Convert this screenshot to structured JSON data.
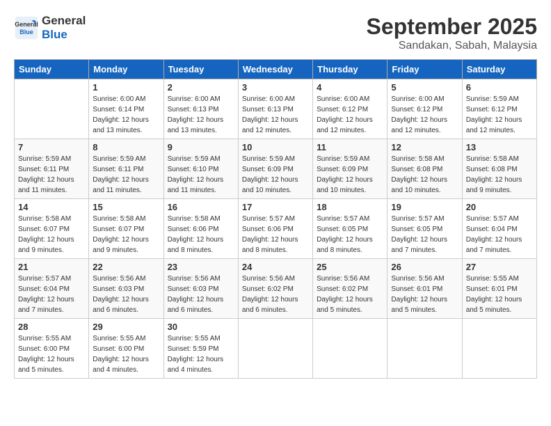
{
  "logo": {
    "line1": "General",
    "line2": "Blue"
  },
  "title": "September 2025",
  "subtitle": "Sandakan, Sabah, Malaysia",
  "days_header": [
    "Sunday",
    "Monday",
    "Tuesday",
    "Wednesday",
    "Thursday",
    "Friday",
    "Saturday"
  ],
  "weeks": [
    [
      {
        "num": "",
        "info": ""
      },
      {
        "num": "1",
        "info": "Sunrise: 6:00 AM\nSunset: 6:14 PM\nDaylight: 12 hours\nand 13 minutes."
      },
      {
        "num": "2",
        "info": "Sunrise: 6:00 AM\nSunset: 6:13 PM\nDaylight: 12 hours\nand 13 minutes."
      },
      {
        "num": "3",
        "info": "Sunrise: 6:00 AM\nSunset: 6:13 PM\nDaylight: 12 hours\nand 12 minutes."
      },
      {
        "num": "4",
        "info": "Sunrise: 6:00 AM\nSunset: 6:12 PM\nDaylight: 12 hours\nand 12 minutes."
      },
      {
        "num": "5",
        "info": "Sunrise: 6:00 AM\nSunset: 6:12 PM\nDaylight: 12 hours\nand 12 minutes."
      },
      {
        "num": "6",
        "info": "Sunrise: 5:59 AM\nSunset: 6:12 PM\nDaylight: 12 hours\nand 12 minutes."
      }
    ],
    [
      {
        "num": "7",
        "info": "Sunrise: 5:59 AM\nSunset: 6:11 PM\nDaylight: 12 hours\nand 11 minutes."
      },
      {
        "num": "8",
        "info": "Sunrise: 5:59 AM\nSunset: 6:11 PM\nDaylight: 12 hours\nand 11 minutes."
      },
      {
        "num": "9",
        "info": "Sunrise: 5:59 AM\nSunset: 6:10 PM\nDaylight: 12 hours\nand 11 minutes."
      },
      {
        "num": "10",
        "info": "Sunrise: 5:59 AM\nSunset: 6:09 PM\nDaylight: 12 hours\nand 10 minutes."
      },
      {
        "num": "11",
        "info": "Sunrise: 5:59 AM\nSunset: 6:09 PM\nDaylight: 12 hours\nand 10 minutes."
      },
      {
        "num": "12",
        "info": "Sunrise: 5:58 AM\nSunset: 6:08 PM\nDaylight: 12 hours\nand 10 minutes."
      },
      {
        "num": "13",
        "info": "Sunrise: 5:58 AM\nSunset: 6:08 PM\nDaylight: 12 hours\nand 9 minutes."
      }
    ],
    [
      {
        "num": "14",
        "info": "Sunrise: 5:58 AM\nSunset: 6:07 PM\nDaylight: 12 hours\nand 9 minutes."
      },
      {
        "num": "15",
        "info": "Sunrise: 5:58 AM\nSunset: 6:07 PM\nDaylight: 12 hours\nand 9 minutes."
      },
      {
        "num": "16",
        "info": "Sunrise: 5:58 AM\nSunset: 6:06 PM\nDaylight: 12 hours\nand 8 minutes."
      },
      {
        "num": "17",
        "info": "Sunrise: 5:57 AM\nSunset: 6:06 PM\nDaylight: 12 hours\nand 8 minutes."
      },
      {
        "num": "18",
        "info": "Sunrise: 5:57 AM\nSunset: 6:05 PM\nDaylight: 12 hours\nand 8 minutes."
      },
      {
        "num": "19",
        "info": "Sunrise: 5:57 AM\nSunset: 6:05 PM\nDaylight: 12 hours\nand 7 minutes."
      },
      {
        "num": "20",
        "info": "Sunrise: 5:57 AM\nSunset: 6:04 PM\nDaylight: 12 hours\nand 7 minutes."
      }
    ],
    [
      {
        "num": "21",
        "info": "Sunrise: 5:57 AM\nSunset: 6:04 PM\nDaylight: 12 hours\nand 7 minutes."
      },
      {
        "num": "22",
        "info": "Sunrise: 5:56 AM\nSunset: 6:03 PM\nDaylight: 12 hours\nand 6 minutes."
      },
      {
        "num": "23",
        "info": "Sunrise: 5:56 AM\nSunset: 6:03 PM\nDaylight: 12 hours\nand 6 minutes."
      },
      {
        "num": "24",
        "info": "Sunrise: 5:56 AM\nSunset: 6:02 PM\nDaylight: 12 hours\nand 6 minutes."
      },
      {
        "num": "25",
        "info": "Sunrise: 5:56 AM\nSunset: 6:02 PM\nDaylight: 12 hours\nand 5 minutes."
      },
      {
        "num": "26",
        "info": "Sunrise: 5:56 AM\nSunset: 6:01 PM\nDaylight: 12 hours\nand 5 minutes."
      },
      {
        "num": "27",
        "info": "Sunrise: 5:55 AM\nSunset: 6:01 PM\nDaylight: 12 hours\nand 5 minutes."
      }
    ],
    [
      {
        "num": "28",
        "info": "Sunrise: 5:55 AM\nSunset: 6:00 PM\nDaylight: 12 hours\nand 5 minutes."
      },
      {
        "num": "29",
        "info": "Sunrise: 5:55 AM\nSunset: 6:00 PM\nDaylight: 12 hours\nand 4 minutes."
      },
      {
        "num": "30",
        "info": "Sunrise: 5:55 AM\nSunset: 5:59 PM\nDaylight: 12 hours\nand 4 minutes."
      },
      {
        "num": "",
        "info": ""
      },
      {
        "num": "",
        "info": ""
      },
      {
        "num": "",
        "info": ""
      },
      {
        "num": "",
        "info": ""
      }
    ]
  ]
}
